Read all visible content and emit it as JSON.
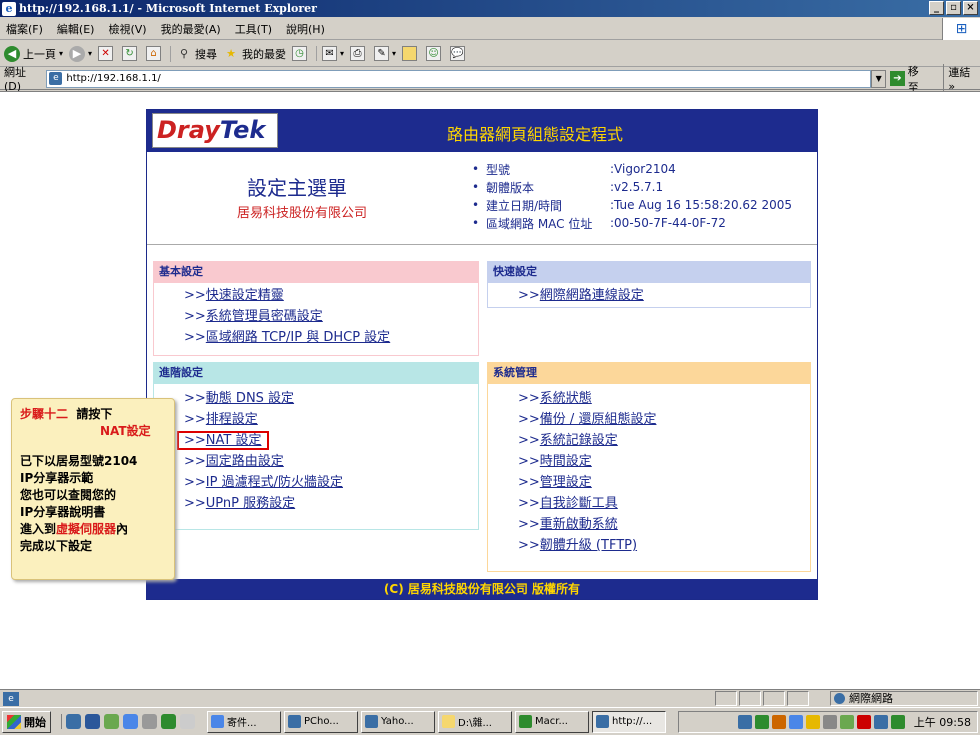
{
  "window": {
    "title": "http://192.168.1.1/ - Microsoft Internet Explorer",
    "min": "_",
    "max": "▫",
    "close": "×"
  },
  "menu": [
    "檔案(F)",
    "編輯(E)",
    "檢視(V)",
    "我的最愛(A)",
    "工具(T)",
    "說明(H)"
  ],
  "toolbar": {
    "back": "上一頁",
    "search": "搜尋",
    "favorites": "我的最愛"
  },
  "address": {
    "label": "網址(D)",
    "url": "http://192.168.1.1/",
    "go": "移至",
    "links": "連結 »"
  },
  "page": {
    "logo_a": "Dray",
    "logo_b": "Tek",
    "header_title": "路由器網頁組態設定程式",
    "main_title": "設定主選單",
    "company": "居易科技股份有限公司",
    "specs": [
      {
        "label": "型號",
        "value": ":Vigor2104"
      },
      {
        "label": "韌體版本",
        "value": ":v2.5.7.1"
      },
      {
        "label": "建立日期/時間",
        "value": ":Tue Aug 16 15:58:20.62 2005"
      },
      {
        "label": "區域網路 MAC 位址",
        "value": ":00-50-7F-44-0F-72"
      }
    ],
    "basic": {
      "title": "基本設定",
      "links": [
        "快速設定精靈",
        "系統管理員密碼設定",
        "區域網路 TCP/IP 與 DHCP 設定"
      ]
    },
    "quick": {
      "title": "快速設定",
      "links": [
        "網際網路連線設定"
      ]
    },
    "advanced": {
      "title": "進階設定",
      "links": [
        "動態 DNS 設定",
        "排程設定",
        "NAT 設定",
        "固定路由設定",
        "IP 過濾程式/防火牆設定",
        "UPnP 服務設定"
      ]
    },
    "system": {
      "title": "系統管理",
      "links": [
        "系統狀態",
        "備份 / 還原組態設定",
        "系統記錄設定",
        "時間設定",
        "管理設定",
        "自我診斷工具",
        "重新啟動系統",
        "韌體升級 (TFTP)"
      ]
    },
    "arrow": ">>",
    "footer": "(C) 居易科技股份有限公司 版權所有"
  },
  "note": {
    "step": "步驟十二",
    "instr": "請按下",
    "target": "NAT設定",
    "line1": "已下以居易型號2104",
    "line2": "IP分享器示範",
    "line3": "您也可以查閱您的",
    "line4": "IP分享器說明書",
    "line5_a": "進入到",
    "line5_b": "虛擬伺服器",
    "line5_c": "內",
    "line6": "完成以下設定"
  },
  "status": {
    "zone": "網際網路"
  },
  "taskbar": {
    "start": "開始",
    "tasks": [
      "寄件...",
      "PCho...",
      "Yaho...",
      "D:\\雜...",
      "Macr...",
      "http://..."
    ],
    "clock": "上午 09:58"
  }
}
